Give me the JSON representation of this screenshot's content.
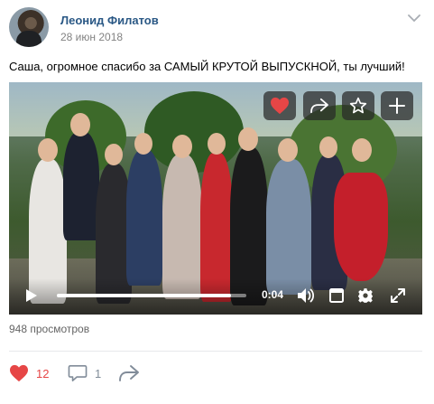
{
  "post": {
    "author": "Леонид Филатов",
    "date": "28 июн 2018",
    "text": "Саша, огромное спасибо за САМЫЙ КРУТОЙ ВЫПУСКНОЙ, ты лучший!",
    "views": "948 просмотров"
  },
  "video": {
    "time": "0:04",
    "progress_fraction": 0.92,
    "like_color": "#e64646"
  },
  "actions": {
    "likes": "12",
    "comments": "1",
    "like_color": "#e64646",
    "icon_color": "#818c99"
  },
  "colors": {
    "author_link": "#2a5885",
    "meta_text": "#828282"
  }
}
